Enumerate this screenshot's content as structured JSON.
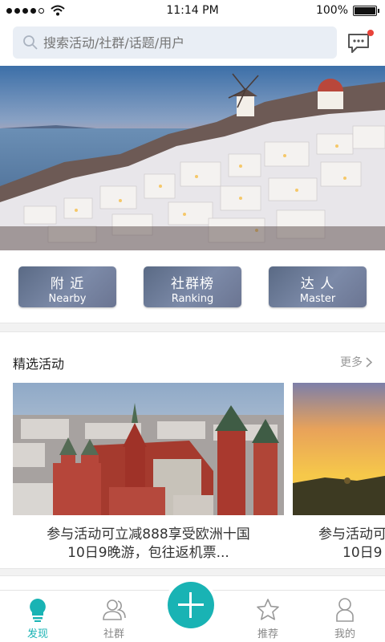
{
  "status_bar": {
    "time": "11:14 PM",
    "battery": "100%",
    "signal_bars_filled": 4,
    "signal_bars_total": 5
  },
  "search": {
    "placeholder": "搜索活动/社群/话题/用户"
  },
  "categories": [
    {
      "cn": "附 近",
      "en": "Nearby"
    },
    {
      "cn": "社群榜",
      "en": "Ranking"
    },
    {
      "cn": "达 人",
      "en": "Master"
    }
  ],
  "section": {
    "title": "精选活动",
    "more": "更多"
  },
  "cards": [
    {
      "line1": "参与活动可立减888享受欧洲十国",
      "line2": "10日9晚游，包往返机票..."
    },
    {
      "line1": "参与活动可",
      "line2": "10日9"
    }
  ],
  "tabs": [
    {
      "label": "发现",
      "icon": "lightbulb-icon",
      "active": true
    },
    {
      "label": "社群",
      "icon": "group-icon",
      "active": false
    },
    {
      "label": "推荐",
      "icon": "star-icon",
      "active": false
    },
    {
      "label": "我的",
      "icon": "person-icon",
      "active": false
    }
  ],
  "colors": {
    "accent": "#19b3b4",
    "badge": "#e8433a"
  }
}
